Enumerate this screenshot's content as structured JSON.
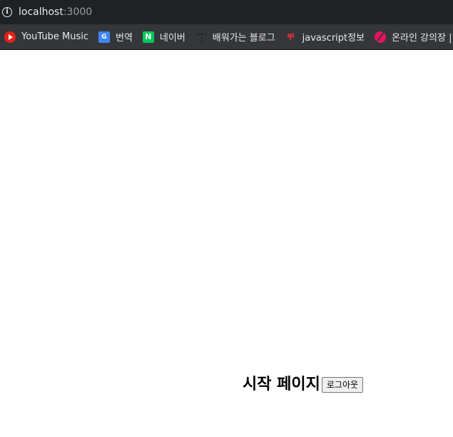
{
  "browser": {
    "url_host": "localhost",
    "url_port": ":3000"
  },
  "bookmarks": [
    {
      "label": "YouTube Music",
      "icon": "youtube-music-icon"
    },
    {
      "label": "번역",
      "icon": "translate-icon"
    },
    {
      "label": "네이버",
      "icon": "naver-icon"
    },
    {
      "label": "배워가는 블로그",
      "icon": "blog-dots-icon"
    },
    {
      "label": "javascript정보",
      "icon": "javascript-info-icon"
    },
    {
      "label": "온라인 강의장 | 패",
      "icon": "online-lecture-icon"
    }
  ],
  "page": {
    "title": "시작 페이지",
    "logout_label": "로그아웃"
  }
}
